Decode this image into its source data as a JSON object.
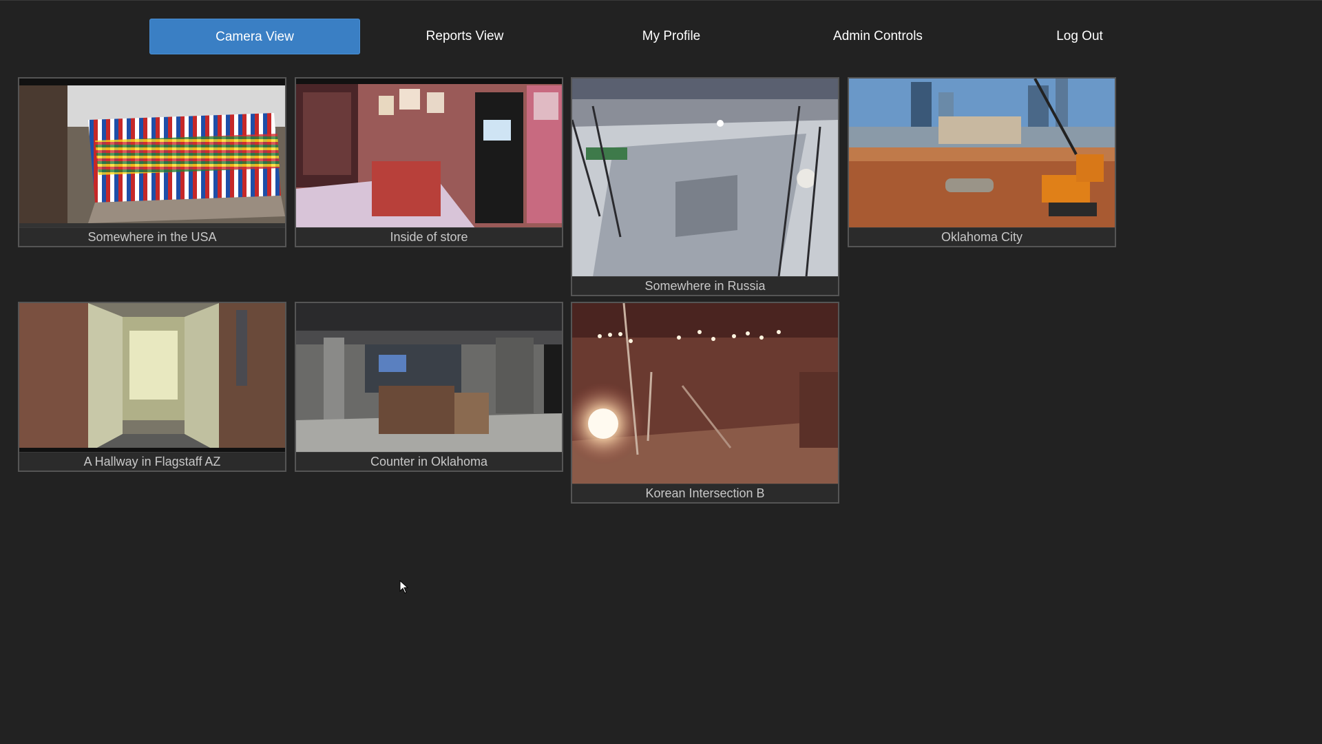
{
  "nav": {
    "camera_view": "Camera View",
    "reports_view": "Reports View",
    "my_profile": "My Profile",
    "admin_controls": "Admin Controls",
    "log_out": "Log Out",
    "active": "Camera View"
  },
  "cameras": [
    {
      "label": "Somewhere in the USA"
    },
    {
      "label": "Inside of store"
    },
    {
      "label": "Somewhere in Russia"
    },
    {
      "label": "Oklahoma City"
    },
    {
      "label": "A Hallway in Flagstaff AZ"
    },
    {
      "label": "Counter in Oklahoma"
    },
    {
      "label": "Korean Intersection B"
    }
  ],
  "colors": {
    "background": "#222222",
    "accent": "#3a7fc4",
    "tile_border": "#555555",
    "caption_text": "#c8c8c8"
  }
}
